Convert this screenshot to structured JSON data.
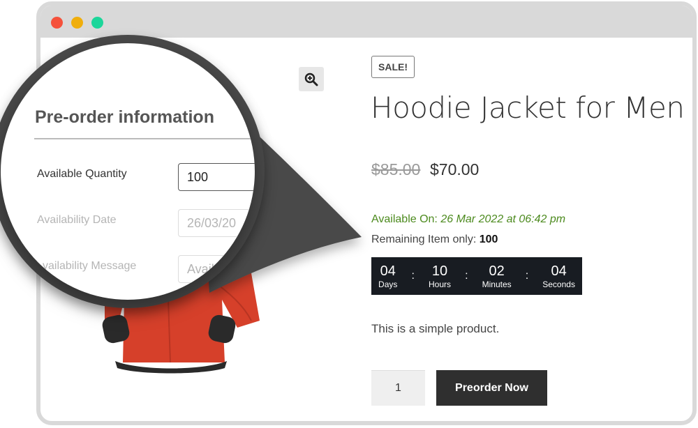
{
  "window": {
    "controls": [
      "close",
      "minimize",
      "maximize"
    ]
  },
  "gallery": {
    "zoom_icon": "zoom-in-icon"
  },
  "product": {
    "badge": "SALE!",
    "title": "Hoodie Jacket for Men",
    "price_old": "$85.00",
    "price_new": "$70.00",
    "available_label": "Available On:",
    "available_date": "26 Mar 2022 at 06:42 pm",
    "remaining_label": "Remaining Item only:",
    "remaining_value": "100",
    "description": "This is a simple product.",
    "quantity": "1",
    "button": "Preorder Now"
  },
  "countdown": [
    {
      "value": "04",
      "label": "Days"
    },
    {
      "value": "10",
      "label": "Hours"
    },
    {
      "value": "02",
      "label": "Minutes"
    },
    {
      "value": "04",
      "label": "Seconds"
    }
  ],
  "preorder_panel": {
    "heading": "Pre-order information",
    "fields": [
      {
        "label": "Available Quantity",
        "value": "100"
      },
      {
        "label": "Availability Date",
        "value": "26/03/20"
      },
      {
        "label": "vailability Message",
        "value": "Avail"
      }
    ]
  },
  "colors": {
    "available_green": "#4c8a1e",
    "countdown_bg": "#181c22",
    "button_bg": "#2f2f2f",
    "jacket_red": "#d6402a"
  }
}
